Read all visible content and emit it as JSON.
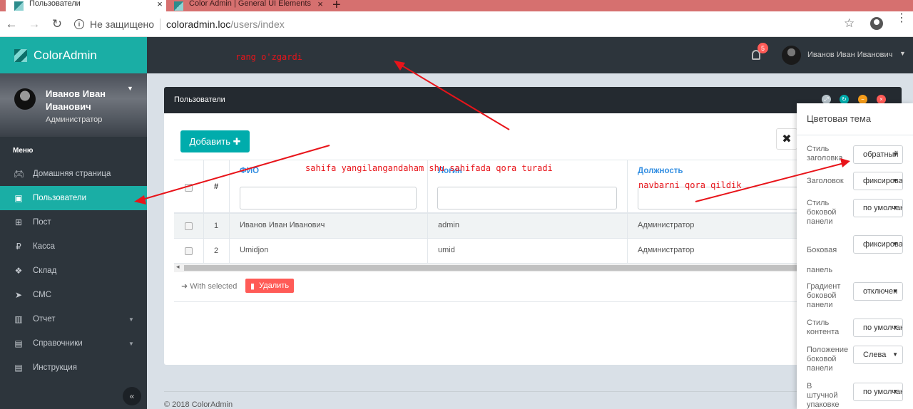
{
  "browser": {
    "tabs": [
      {
        "title": "Пользователи",
        "close": "×"
      },
      {
        "title": "Color Admin | General UI Elements",
        "close": "×"
      }
    ],
    "new_tab": "+",
    "insecure_label": "Не защищено",
    "url_host": "coloradmin.loc",
    "url_path": "/users/index"
  },
  "app": {
    "brand": "ColorAdmin",
    "notification_count": "5",
    "top_user": "Иванов Иван Иванович"
  },
  "sidebar": {
    "profile_name": "Иванов Иван Иванович",
    "profile_role": "Администратор",
    "menu_header": "Меню",
    "items": [
      {
        "label": "Домашняя страница",
        "icon": "gamepad-icon"
      },
      {
        "label": "Пользователи",
        "icon": "card-icon"
      },
      {
        "label": "Пост",
        "icon": "cart-icon"
      },
      {
        "label": "Касса",
        "icon": "ruble-icon"
      },
      {
        "label": "Склад",
        "icon": "cubes-icon"
      },
      {
        "label": "СМС",
        "icon": "send-icon"
      },
      {
        "label": "Отчет",
        "icon": "chart-icon"
      },
      {
        "label": "Справочники",
        "icon": "book-icon"
      },
      {
        "label": "Инструкция",
        "icon": "book-icon"
      }
    ],
    "collapse": "«"
  },
  "panel": {
    "title": "Пользователи",
    "add_button": "Добавить ✚",
    "close_filter": "✖",
    "columns": {
      "hash": "#",
      "fio": "ФИО",
      "login": "Логин",
      "position": "Должность"
    },
    "rows": [
      {
        "num": "1",
        "fio": "Иванов Иван Иванович",
        "login": "admin",
        "position": "Администратор"
      },
      {
        "num": "2",
        "fio": "Umidjon",
        "login": "umid",
        "position": "Администратор"
      }
    ],
    "with_selected": "With selected",
    "delete_button": "Удалить"
  },
  "footer": "© 2018 ColorAdmin",
  "theme_panel": {
    "title": "Цветовая тема",
    "settings": [
      {
        "label": "Стиль заголовка",
        "value": "обратный"
      },
      {
        "label": "Заголовок",
        "value": "фиксированный"
      },
      {
        "label": "Стиль боковой панели",
        "value": "по умолчанию"
      },
      {
        "label": "Боковая панель",
        "value": "фиксированная"
      },
      {
        "label": "Градиент боковой панели",
        "value": "отключен"
      },
      {
        "label": "Стиль контента",
        "value": "по умолчанию"
      },
      {
        "label": "Положение боковой панели",
        "value": "Слева"
      },
      {
        "label": "В штучной упаковке",
        "value": "по умолчанию"
      }
    ]
  },
  "annotations": {
    "header_note": "rang o'zgardi",
    "sidebar_note": "sahifa yangilangandaham shu sahifada qora turadi",
    "navbar_note": "navbarni qora qildik"
  },
  "colors": {
    "accent": "#1aaea5",
    "dark": "#2d353c",
    "danger": "#ff5b57",
    "annotation": "#e8141a"
  }
}
